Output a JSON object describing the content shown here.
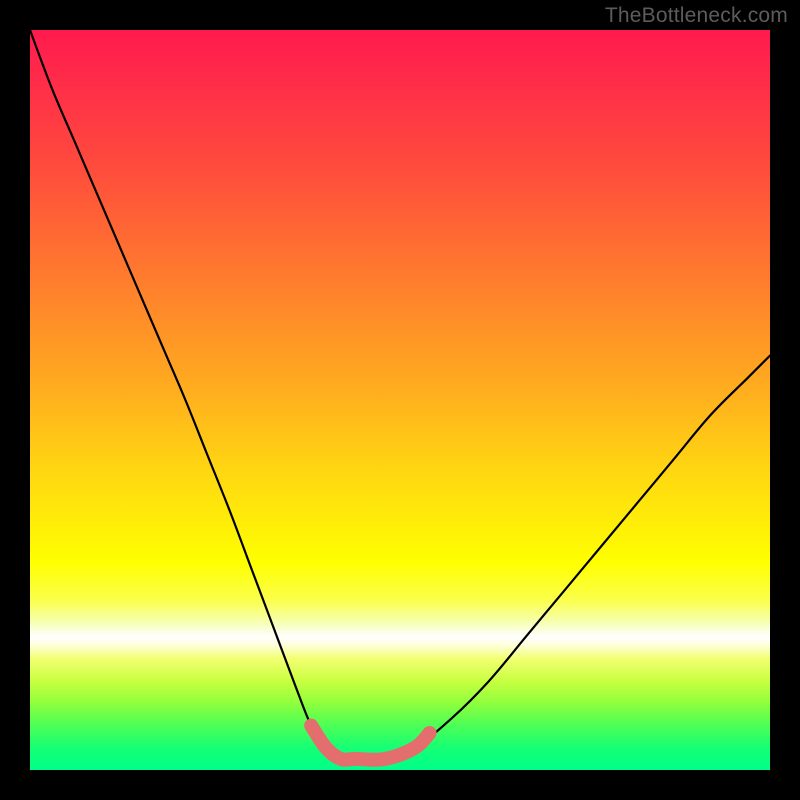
{
  "watermark": "TheBottleneck.com",
  "colors": {
    "frame_background": "#000000",
    "curve_stroke": "#000000",
    "highlight_stroke": "#e46e6e",
    "gradient_top": "#ff1a4d",
    "gradient_mid": "#feff00",
    "gradient_bottom": "#00ff88"
  },
  "chart_data": {
    "type": "line",
    "title": "",
    "xlabel": "",
    "ylabel": "",
    "xlim": [
      0,
      100
    ],
    "ylim": [
      0,
      100
    ],
    "grid": false,
    "legend": false,
    "series": [
      {
        "name": "bottleneck-curve",
        "x": [
          0,
          3,
          6,
          9,
          12,
          15,
          18,
          21,
          24,
          27,
          30,
          33,
          36,
          38,
          40,
          42,
          44,
          48,
          52,
          57,
          62,
          67,
          72,
          77,
          82,
          87,
          92,
          97,
          100
        ],
        "y": [
          100,
          92,
          85,
          78,
          71,
          64,
          57,
          50,
          42.5,
          35,
          27,
          19,
          11,
          6,
          3,
          1.5,
          1.5,
          1.5,
          3,
          7,
          12,
          18,
          24,
          30,
          36,
          42,
          48,
          53,
          56
        ]
      },
      {
        "name": "optimal-range",
        "x": [
          38,
          40,
          42,
          44,
          48,
          52,
          54
        ],
        "y": [
          6,
          3,
          1.5,
          1.5,
          1.5,
          3,
          5
        ]
      }
    ],
    "annotations": []
  }
}
